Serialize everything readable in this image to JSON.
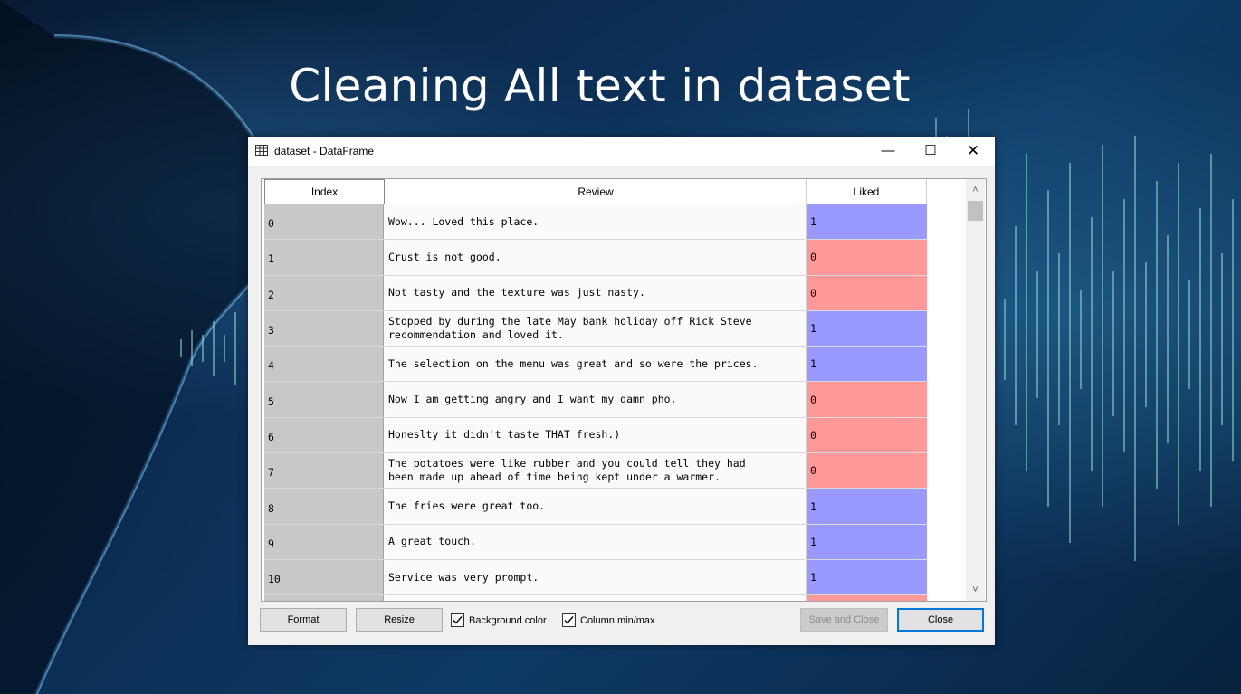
{
  "slide": {
    "title": "Cleaning All text in dataset"
  },
  "window": {
    "title": "dataset - DataFrame",
    "icon": "table-icon",
    "controls": {
      "minimize": "—",
      "maximize": "☐",
      "close": "✕"
    }
  },
  "table": {
    "columns": [
      "Index",
      "Review",
      "Liked"
    ],
    "rows": [
      {
        "index": "0",
        "review": "Wow... Loved this place.",
        "liked": "1"
      },
      {
        "index": "1",
        "review": "Crust is not good.",
        "liked": "0"
      },
      {
        "index": "2",
        "review": "Not tasty and the texture was just nasty.",
        "liked": "0"
      },
      {
        "index": "3",
        "review": "Stopped by during the late May bank holiday off Rick Steve\nrecommendation and loved it.",
        "liked": "1"
      },
      {
        "index": "4",
        "review": "The selection on the menu was great and so were the prices.",
        "liked": "1"
      },
      {
        "index": "5",
        "review": "Now I am getting angry and I want my damn pho.",
        "liked": "0"
      },
      {
        "index": "6",
        "review": "Honeslty it didn't taste THAT fresh.)",
        "liked": "0"
      },
      {
        "index": "7",
        "review": "The potatoes were like rubber and you could tell they had\nbeen made up ahead of time being kept under a warmer.",
        "liked": "0"
      },
      {
        "index": "8",
        "review": "The fries were great too.",
        "liked": "1"
      },
      {
        "index": "9",
        "review": "A great touch.",
        "liked": "1"
      },
      {
        "index": "10",
        "review": "Service was very prompt.",
        "liked": "1"
      }
    ],
    "colors": {
      "liked_1": "#9999ff",
      "liked_0": "#ff9999",
      "index_bg": "#c8c8c8"
    }
  },
  "footer": {
    "format_label": "Format",
    "resize_label": "Resize",
    "background_color_label": "Background color",
    "background_color_checked": true,
    "column_minmax_label": "Column min/max",
    "column_minmax_checked": true,
    "save_close_label": "Save and Close",
    "close_label": "Close"
  }
}
